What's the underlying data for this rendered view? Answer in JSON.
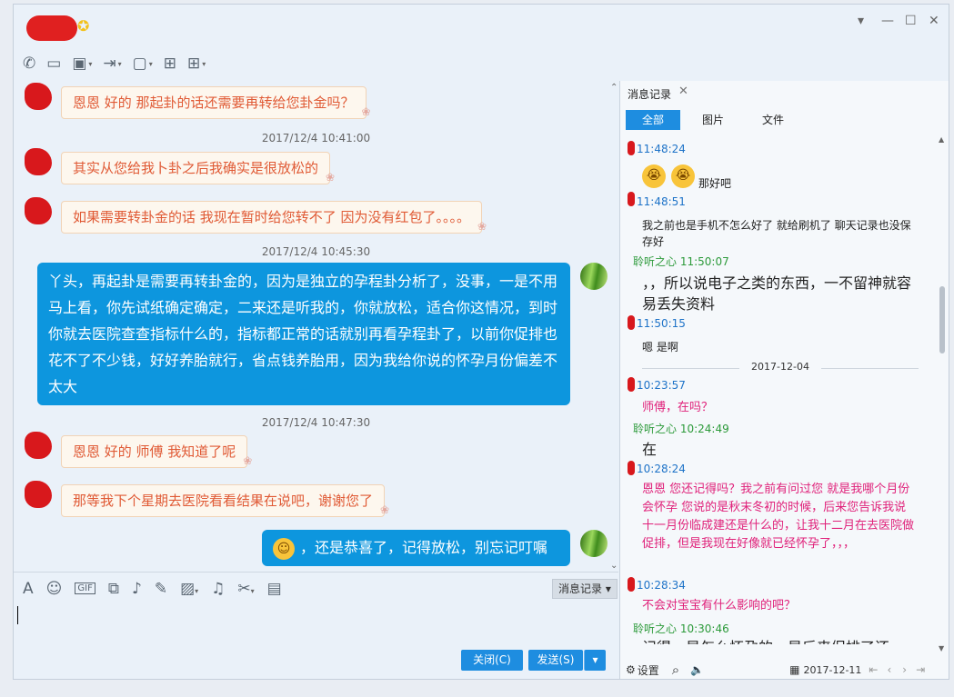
{
  "toolbar_icons": [
    "phone-icon",
    "video-icon",
    "screen-share-icon",
    "file-transfer-icon",
    "remote-desktop-icon",
    "add-comment-icon",
    "apps-icon"
  ],
  "chat": {
    "msg1": "恩恩 好的  那起卦的话还需要再转给您卦金吗？",
    "ts1": "2017/12/4 10:41:00",
    "msg2": "其实从您给我卜卦之后我确实是很放松的",
    "msg3": "如果需要转卦金的话  我现在暂时给您转不了 因为没有红包了。。。。",
    "ts2": "2017/12/4 10:45:30",
    "reply1": "丫头，再起卦是需要再转卦金的，因为是独立的孕程卦分析了，没事，一是不用马上看，你先试纸确定确定，二来还是听我的，你就放松，适合你这情况，到时你就去医院查查指标什么的，指标都正常的话就别再看孕程卦了，以前你促排也花不了不少钱，好好养胎就行，省点钱养胎用，因为我给你说的怀孕月份偏差不太大",
    "ts3": "2017/12/4 10:47:30",
    "msg4": "恩恩  好的 师傅 我知道了呢",
    "msg5": "那等我下个星期去医院看看结果在说吧，谢谢您了",
    "reply2": "，还是恭喜了，记得放松，别忘记叮嘱"
  },
  "input": {
    "history_label": "消息记录",
    "close_label": "关闭(C)",
    "send_label": "发送(S)"
  },
  "history": {
    "tab_label": "消息记录",
    "filters": [
      "全部",
      "图片",
      "文件"
    ],
    "entries": {
      "t1": "11:48:24",
      "e1": "那好吧",
      "t2": "11:48:51",
      "e2": "我之前也是手机不怎么好了 就给刷机了  聊天记录也没保存好",
      "n3": "聆听之心 11:50:07",
      "e3": "，，所以说电子之类的东西，一不留神就容易丢失资料",
      "t4": "11:50:15",
      "e4": "嗯 是啊",
      "date": "2017-12-04",
      "t5": "10:23:57",
      "e5": "师傅，在吗？",
      "n6": "聆听之心 10:24:49",
      "e6": "在",
      "t7": "10:28:24",
      "e7": "恩恩  您还记得吗？我之前有问过您 就是我哪个月份会怀孕  您说的是秋末冬初的时候，后来您告诉我说 十一月份临成建还是什么的，让我十二月在去医院做促排，但是我现在好像就已经怀孕了，，，",
      "t8": "10:28:34",
      "e8": "不会对宝宝有什么影响的吧？",
      "n9": "聆听之心 10:30:46",
      "e9": "记得，是怎么怀孕的，是后来促排了还"
    },
    "footer_settings": "设置",
    "footer_date": "2017-12-11"
  }
}
